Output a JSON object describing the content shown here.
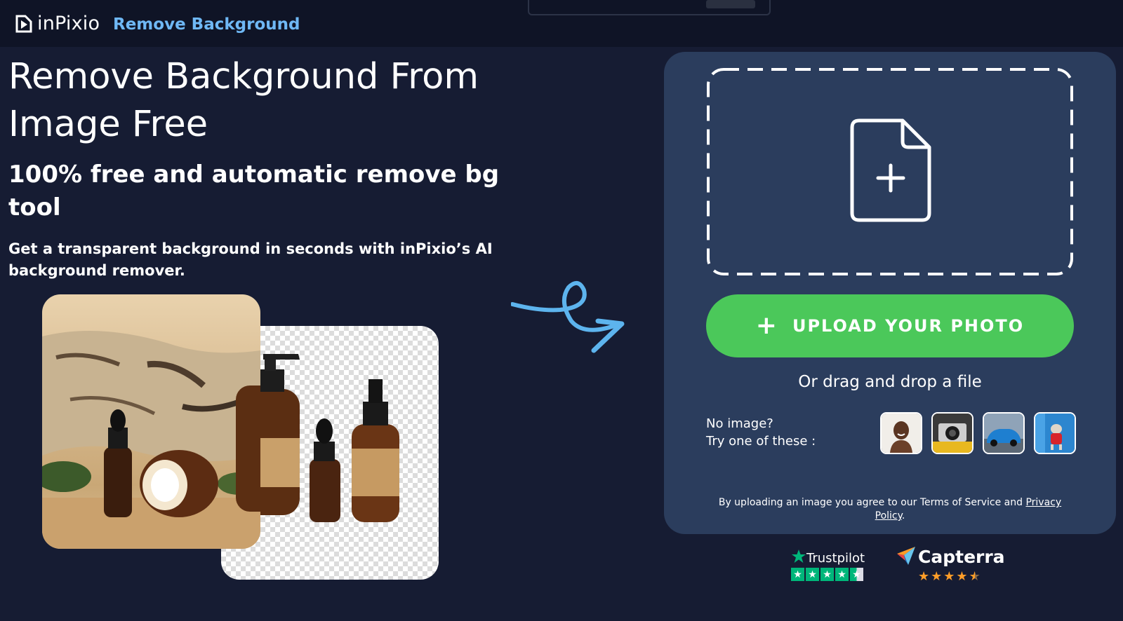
{
  "header": {
    "logo_text": "inPixio",
    "nav_link": "Remove Background"
  },
  "hero": {
    "title": "Remove Background From Image Free",
    "subtitle": "100% free and automatic remove bg tool",
    "lead": "Get a transparent background in seconds with inPixio’s AI background remover."
  },
  "upload": {
    "button_label": "UPLOAD YOUR PHOTO",
    "drag_text": "Or drag and drop a file",
    "no_image_line1": "No image?",
    "no_image_line2": "Try one of these :",
    "samples": [
      {
        "icon": "portrait-sample-icon"
      },
      {
        "icon": "camera-sample-icon"
      },
      {
        "icon": "car-sample-icon"
      },
      {
        "icon": "dog-sample-icon"
      }
    ],
    "terms_text": "By uploading an image you agree to our Terms of Service and ",
    "privacy_link": "Privacy Policy",
    "terms_end": "."
  },
  "ratings": {
    "trustpilot": {
      "name": "Trustpilot",
      "stars": 4.5
    },
    "capterra": {
      "name": "Capterra",
      "stars": 4.5
    }
  },
  "colors": {
    "background": "#161c33",
    "header": "#0f1426",
    "card": "#2b3d5d",
    "accent_green": "#4bc85a",
    "link_blue": "#6fb8f5",
    "trustpilot_green": "#00b67a",
    "capterra_orange": "#ff9d28"
  }
}
